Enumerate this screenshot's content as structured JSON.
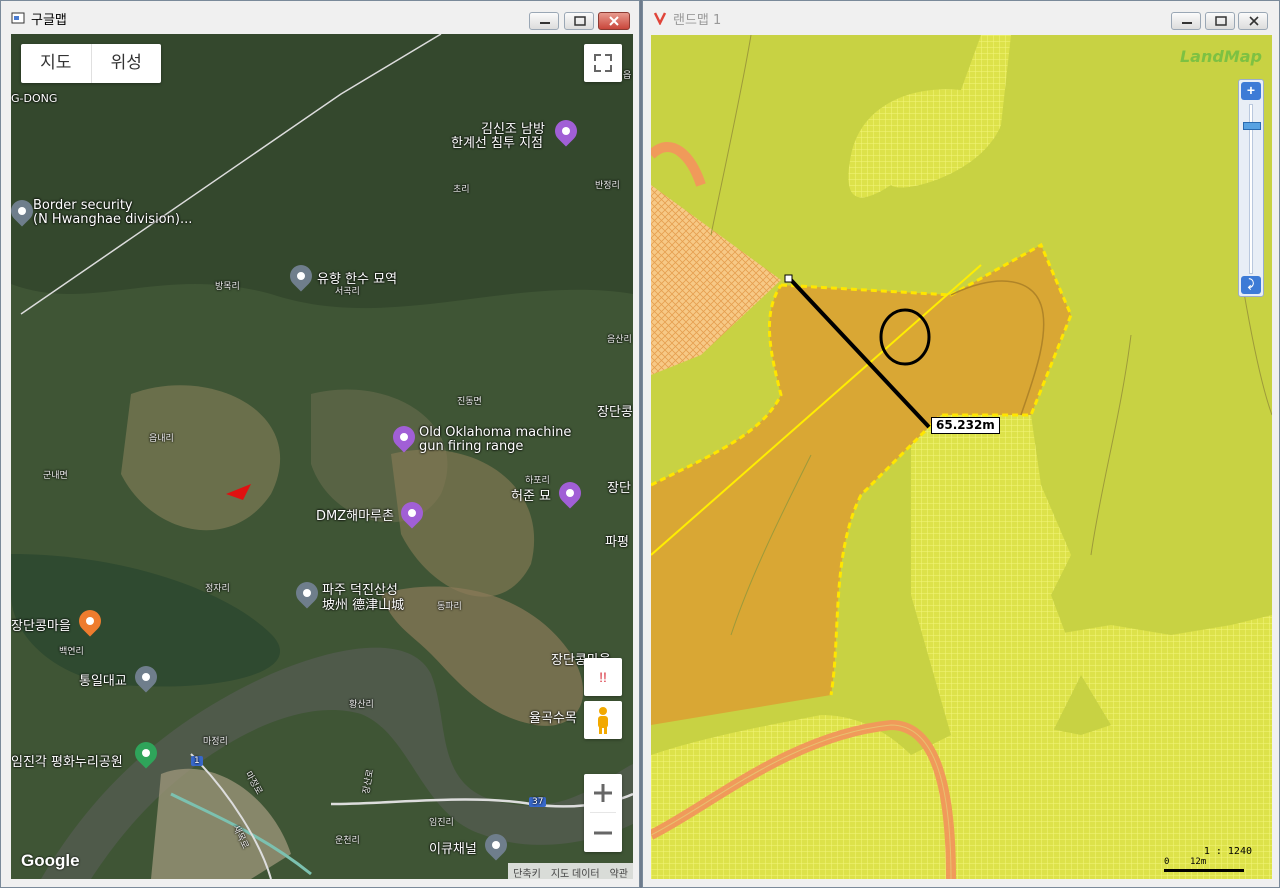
{
  "left_window": {
    "title": "구글맵",
    "map_type": {
      "map": "지도",
      "satellite": "위성"
    },
    "labels": {
      "g_dong": "G-DONG",
      "kim_shin_jo": "김신조 남방",
      "kim_shin_jo2": "한계선 침투 지점",
      "border": "Border security",
      "border2": "(N Hwanghae division)...",
      "yuhyang": "유향 한수 묘역",
      "old_ok": "Old Oklahoma machine",
      "old_ok2": "gun firing range",
      "heojun": "허준 묘",
      "dmz": "DMZ해마루촌",
      "paju": "파주 덕진산성",
      "paju2": "坡州 德津山城",
      "jangdan_maeul": "장단콩마을",
      "tongil": "통일대교",
      "jangdan_pro": "장단콩마을",
      "yulgok": "율곡수목",
      "imjingak": "임진각 평화누리공원",
      "ikyu": "이큐채널",
      "jangdan_right": "장단콩",
      "jangdan_r2": "장단",
      "paju_r": "파평",
      "choli": "초리",
      "banjeong": "반정리",
      "bangmok": "방목리",
      "seogok": "서곡리",
      "eupnae": "읍내리",
      "gunnae": "군내면",
      "jindong": "진동면",
      "hapori": "하포리",
      "jeongja": "정자리",
      "dongpa": "동파리",
      "baekyeon": "백연리",
      "hwangsan": "황산리",
      "majeong": "마정리",
      "imjin": "임진리",
      "unjeong": "운천리",
      "eumsan": "음산리",
      "road1": "1",
      "road37": "37",
      "magyeong_ro": "마정로",
      "saemokro": "새목로",
      "jangsan_ro": "장산로",
      "eup": "읍"
    },
    "footer": {
      "shortcut": "단축키",
      "map_data": "지도 데이터",
      "terms": "약관"
    },
    "google": "Google",
    "alert": "!!"
  },
  "right_window": {
    "title": "랜드맵 1",
    "logo": "LandMap",
    "measurement": "65.232m",
    "scale": "1 : 1240",
    "scale_zero": "0",
    "scale_len": "12m",
    "zoom_in": "+",
    "zoom_reset": "⤸"
  }
}
